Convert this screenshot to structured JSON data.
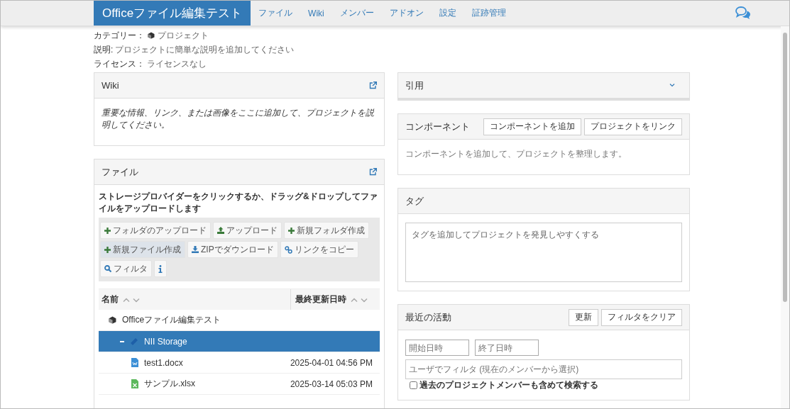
{
  "navbar": {
    "brand": "Officeファイル編集テスト",
    "items": [
      "ファイル",
      "Wiki",
      "メンバー",
      "アドオン",
      "設定",
      "証跡管理"
    ]
  },
  "project_info": [
    {
      "label": "カテゴリー：",
      "value": "プロジェクト",
      "kind": "category"
    },
    {
      "label": "説明:",
      "value": "プロジェクトに簡単な説明を追加してください",
      "kind": "text"
    },
    {
      "label": "ライセンス：",
      "value": "ライセンスなし",
      "kind": "text"
    }
  ],
  "wiki": {
    "title": "Wiki",
    "body": "重要な情報、リンク、または画像をここに追加して、プロジェクトを説明してください。"
  },
  "files": {
    "title": "ファイル",
    "instructions": "ストレージプロバイダーをクリックするか、ドラッグ&ドロップしてファイルをアップロードします",
    "toolbar": [
      {
        "label": "フォルダのアップロード",
        "kind": "plus",
        "active": false
      },
      {
        "label": "アップロード",
        "kind": "upload",
        "active": false
      },
      {
        "label": "新規フォルダ作成",
        "kind": "plus",
        "active": false
      },
      {
        "label": "新規ファイル作成",
        "kind": "plus",
        "active": true
      },
      {
        "label": "ZIPでダウンロード",
        "kind": "download",
        "active": false
      },
      {
        "label": "リンクをコピー",
        "kind": "link",
        "active": false
      },
      {
        "label": "フィルタ",
        "kind": "search",
        "active": false
      },
      {
        "kind": "info",
        "active": false
      }
    ],
    "columns": [
      "名前",
      "最終更新日時"
    ],
    "tree": [
      {
        "name": "Officeファイル編集テスト",
        "kind": "project",
        "selected": false,
        "children": [
          {
            "name": "NII Storage",
            "kind": "storage",
            "selected": true,
            "expanded": true,
            "children": [
              {
                "name": "test1.docx",
                "kind": "word",
                "modified": "2025-04-01 04:56 PM",
                "selected": false
              },
              {
                "name": "サンプル.xlsx",
                "kind": "excel",
                "modified": "2025-03-14 05:03 PM",
                "selected": false
              }
            ]
          }
        ]
      }
    ]
  },
  "citation": {
    "title": "引用",
    "expanded": false
  },
  "components": {
    "title": "コンポーネント",
    "buttons": [
      "コンポーネントを追加",
      "プロジェクトをリンク"
    ],
    "body": "コンポーネントを追加して、プロジェクトを整理します。"
  },
  "tags": {
    "title": "タグ",
    "placeholder": "タグを追加してプロジェクトを発見しやすくする"
  },
  "activity": {
    "title": "最近の活動",
    "buttons": [
      "更新",
      "フィルタをクリア"
    ],
    "start_placeholder": "開始日時",
    "end_placeholder": "終了日時",
    "user_placeholder": "ユーザでフィルタ (現在のメンバーから選択)",
    "include_past": {
      "label": "過去のプロジェクトメンバーも含めて検索する",
      "checked": false
    }
  }
}
